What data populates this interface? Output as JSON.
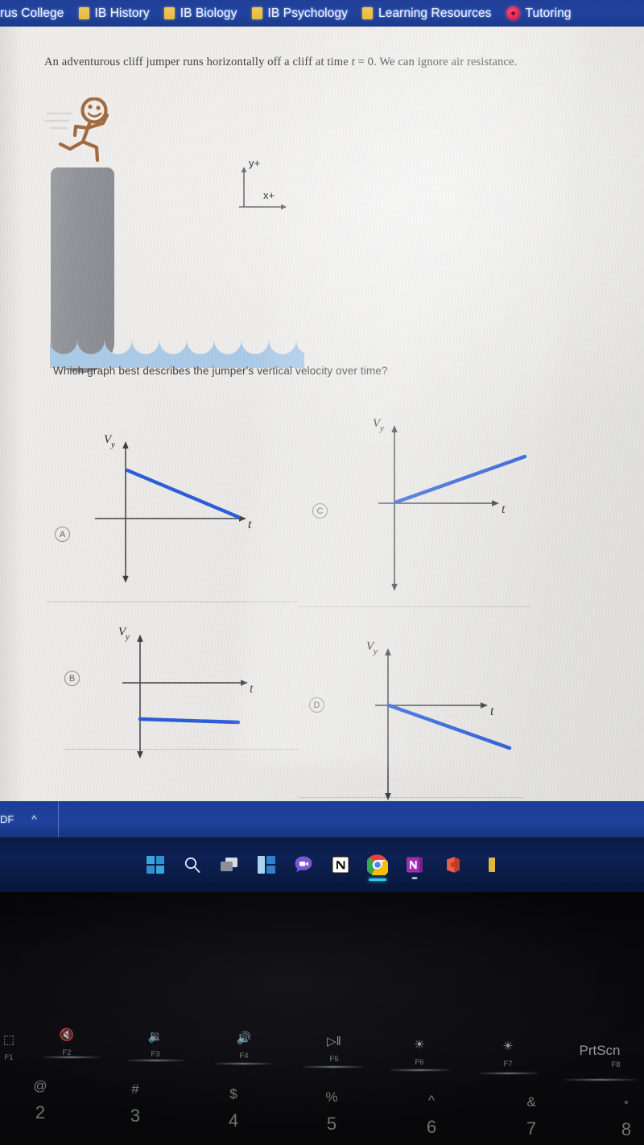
{
  "browser": {
    "bookmarks": [
      {
        "label": "rus College",
        "icon": "none"
      },
      {
        "label": "IB History",
        "icon": "folder-icon"
      },
      {
        "label": "IB Biology",
        "icon": "folder-icon"
      },
      {
        "label": "IB Psychology",
        "icon": "folder-icon"
      },
      {
        "label": "Learning Resources",
        "icon": "folder-icon"
      },
      {
        "label": "Tutoring",
        "icon": "tutoring-icon"
      }
    ],
    "download_bar": {
      "filename": "DF",
      "chevron": "^"
    }
  },
  "question": {
    "prompt_part1": "An adventurous cliff jumper runs horizontally off a cliff at time ",
    "prompt_var": "t",
    "prompt_eq": " = ",
    "prompt_val": "0",
    "prompt_part2": ". We can ignore air resistance.",
    "subquestion": "Which graph best describes the jumper's vertical velocity over time?"
  },
  "illustration": {
    "name": "cliff-jumper-scene",
    "cliff_color": "#8e9095",
    "water_color": "#a9c9e6",
    "figure_color": "#a0663a",
    "axes": {
      "y_label": "y+",
      "x_label": "x+",
      "color": "#6c6c70"
    }
  },
  "chart_data": [
    {
      "id": "A",
      "type": "line",
      "title": "Option A",
      "ylabel": "Vy",
      "xlabel": "t",
      "series": [
        {
          "name": "vy(t)",
          "x": [
            0,
            1
          ],
          "y": [
            0.72,
            0.0
          ]
        }
      ],
      "description": "Starts at a positive value and decreases linearly to zero",
      "line_color": "#2558d6",
      "axis_color": "#3a3a3e",
      "grid": false,
      "legend": "none"
    },
    {
      "id": "B",
      "type": "line",
      "title": "Option B",
      "ylabel": "Vy",
      "xlabel": "t",
      "series": [
        {
          "name": "vy(t)",
          "x": [
            0,
            0.78
          ],
          "y": [
            -0.42,
            -0.46
          ]
        }
      ],
      "description": "Constant negative value, nearly flat horizontal line below the t axis",
      "line_color": "#2558d6",
      "axis_color": "#3a3a3e",
      "grid": false,
      "legend": "none"
    },
    {
      "id": "C",
      "type": "line",
      "title": "Option C",
      "ylabel": "Vy",
      "xlabel": "t",
      "series": [
        {
          "name": "vy(t)",
          "x": [
            0,
            0.88
          ],
          "y": [
            0.0,
            0.62
          ]
        }
      ],
      "description": "Starts at the origin and increases linearly with positive slope",
      "line_color": "#2558d6",
      "axis_color": "#3a3a3e",
      "grid": false,
      "legend": "none"
    },
    {
      "id": "D",
      "type": "line",
      "title": "Option D",
      "ylabel": "Vy",
      "xlabel": "t",
      "series": [
        {
          "name": "vy(t)",
          "x": [
            0,
            0.8
          ],
          "y": [
            0.0,
            -0.55
          ]
        }
      ],
      "description": "Starts at the origin and decreases linearly with negative slope",
      "line_color": "#2558d6",
      "axis_color": "#3a3a3e",
      "grid": false,
      "legend": "none"
    }
  ],
  "options": [
    {
      "id": "A",
      "label": "A"
    },
    {
      "id": "B",
      "label": "B"
    },
    {
      "id": "C",
      "label": "C"
    },
    {
      "id": "D",
      "label": "D"
    }
  ],
  "taskbar": {
    "items": [
      {
        "name": "start-icon",
        "label": "Start"
      },
      {
        "name": "search-icon",
        "label": "Search"
      },
      {
        "name": "task-view-icon",
        "label": "Task View"
      },
      {
        "name": "widgets-icon",
        "label": "Widgets"
      },
      {
        "name": "teams-chat-icon",
        "label": "Chat"
      },
      {
        "name": "notion-icon",
        "label": "Notion"
      },
      {
        "name": "chrome-icon",
        "label": "Google Chrome"
      },
      {
        "name": "onenote-icon",
        "label": "OneNote"
      },
      {
        "name": "office-icon",
        "label": "Office"
      },
      {
        "name": "app-icon-partial",
        "label": ""
      }
    ]
  },
  "keyboard": {
    "function_keys": [
      {
        "glyph": "⬚",
        "fname": "F1"
      },
      {
        "glyph": "🔇",
        "fname": "F2"
      },
      {
        "glyph": "🔉",
        "fname": "F3"
      },
      {
        "glyph": "🔊",
        "fname": "F4"
      },
      {
        "glyph": "▷‖",
        "fname": "F5"
      },
      {
        "glyph": "☀",
        "fname": "F6"
      },
      {
        "glyph": "☀",
        "fname": "F7"
      },
      {
        "glyph": "PrtScn",
        "fname": "F8"
      }
    ],
    "number_keys": [
      {
        "sym": "@",
        "num": "2"
      },
      {
        "sym": "#",
        "num": "3"
      },
      {
        "sym": "$",
        "num": "4"
      },
      {
        "sym": "%",
        "num": "5"
      },
      {
        "sym": "^",
        "num": "6"
      },
      {
        "sym": "&",
        "num": "7"
      },
      {
        "sym": "*",
        "num": "8"
      }
    ]
  }
}
